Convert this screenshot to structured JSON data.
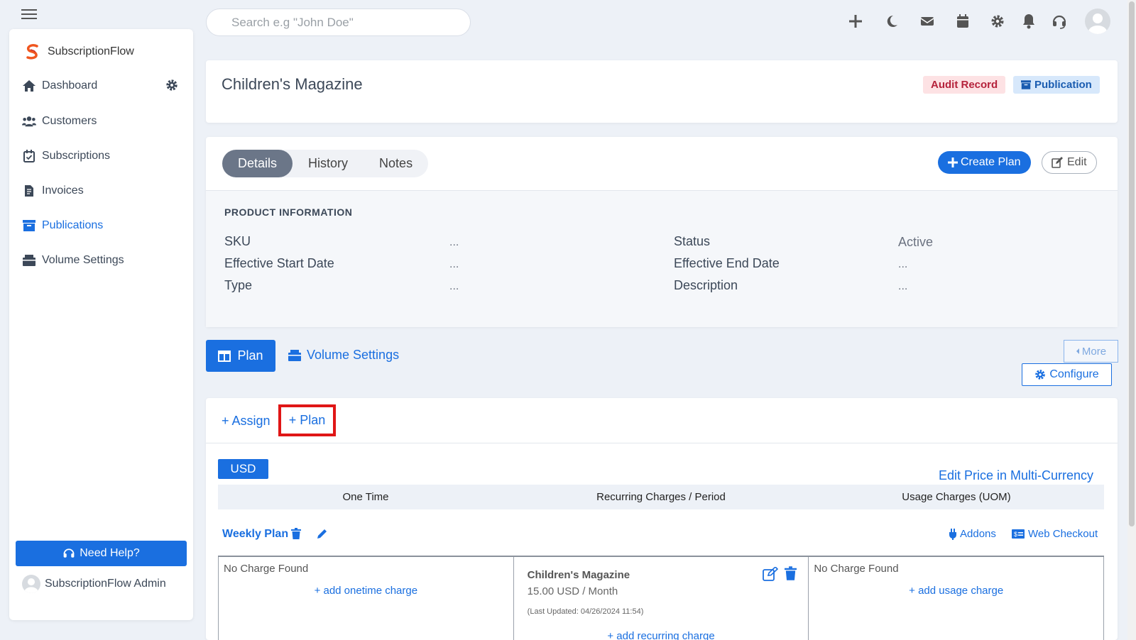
{
  "search": {
    "placeholder": "Search e.g \"John Doe\""
  },
  "topbar": {
    "icons": [
      "plus-icon",
      "moon-icon",
      "mail-icon",
      "calendar-icon",
      "gear-icon",
      "bell-icon",
      "headset-icon",
      "user-avatar"
    ]
  },
  "sidebar": {
    "brand": "SubscriptionFlow",
    "items": [
      {
        "label": "Dashboard",
        "icon": "home-icon",
        "active": false
      },
      {
        "label": "Customers",
        "icon": "users-icon",
        "active": false
      },
      {
        "label": "Subscriptions",
        "icon": "calendar-check-icon",
        "active": false
      },
      {
        "label": "Invoices",
        "icon": "invoice-icon",
        "active": false
      },
      {
        "label": "Publications",
        "icon": "archive-icon",
        "active": true
      },
      {
        "label": "Volume Settings",
        "icon": "box-icon",
        "active": false
      }
    ],
    "help_label": "Need Help?",
    "user_name": "SubscriptionFlow Admin"
  },
  "header": {
    "title": "Children's Magazine",
    "badge_audit": "Audit Record",
    "badge_publication": "Publication"
  },
  "details": {
    "tabs": [
      "Details",
      "History",
      "Notes"
    ],
    "active_tab": "Details",
    "create_plan_label": "Create Plan",
    "edit_label": "Edit",
    "section_title": "PRODUCT INFORMATION",
    "fields": [
      {
        "label": "SKU",
        "value": "..."
      },
      {
        "label": "Effective Start Date",
        "value": "..."
      },
      {
        "label": "Type",
        "value": "..."
      },
      {
        "label": "Status",
        "value": "Active"
      },
      {
        "label": "Effective End Date",
        "value": "..."
      },
      {
        "label": "Description",
        "value": "..."
      }
    ]
  },
  "subnav": {
    "plan_label": "Plan",
    "volume_label": "Volume Settings",
    "more_label": "More",
    "configure_label": "Configure"
  },
  "plans": {
    "assign_label": "+ Assign",
    "add_plan_label": "+ Plan",
    "currency": "USD",
    "multi_currency_label": "Edit Price in Multi-Currency",
    "columns": [
      "One Time",
      "Recurring Charges / Period",
      "Usage Charges (UOM)"
    ],
    "plan_name": "Weekly Plan",
    "addons_label": "Addons",
    "web_checkout_label": "Web Checkout",
    "onetime": {
      "empty": "No Charge Found",
      "add": "+ add onetime charge"
    },
    "recurring": {
      "title": "Children's Magazine",
      "price": "15.00 USD / Month",
      "updated": "(Last Updated: 04/26/2024 11:54)",
      "add": "+ add recurring charge"
    },
    "usage": {
      "empty": "No Charge Found",
      "add": "+ add usage charge"
    }
  },
  "colors": {
    "primary": "#1a6fe0",
    "highlight": "#e01616",
    "audit_bg": "#fde2e4",
    "audit_text": "#b5223b"
  }
}
